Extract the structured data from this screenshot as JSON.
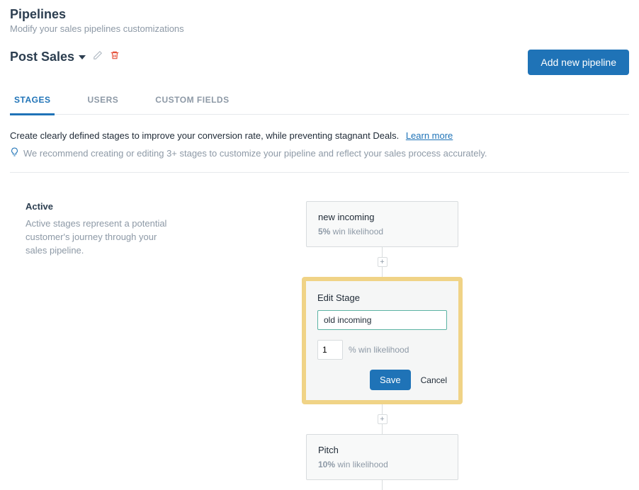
{
  "header": {
    "title": "Pipelines",
    "subtitle": "Modify your sales pipelines customizations",
    "pipeline_name": "Post Sales",
    "add_button": "Add new pipeline"
  },
  "tabs": {
    "stages": "STAGES",
    "users": "USERS",
    "custom": "CUSTOM FIELDS"
  },
  "info": {
    "main": "Create clearly defined stages to improve your conversion rate, while preventing stagnant Deals.",
    "learn": "Learn more",
    "recommend": "We recommend creating or editing 3+ stages to customize your pipeline and reflect your sales process accurately."
  },
  "side": {
    "title": "Active",
    "text": "Active stages represent a potential customer's journey through your sales pipeline."
  },
  "stages": [
    {
      "name": "new incoming",
      "likelihood": "5%"
    },
    {
      "name": "Pitch",
      "likelihood": "10%"
    }
  ],
  "edit": {
    "title": "Edit Stage",
    "name_value": "old incoming",
    "likelihood_value": "1",
    "likelihood_label": "% win likelihood",
    "save": "Save",
    "cancel": "Cancel"
  },
  "labels": {
    "win_suffix": " win likelihood"
  }
}
